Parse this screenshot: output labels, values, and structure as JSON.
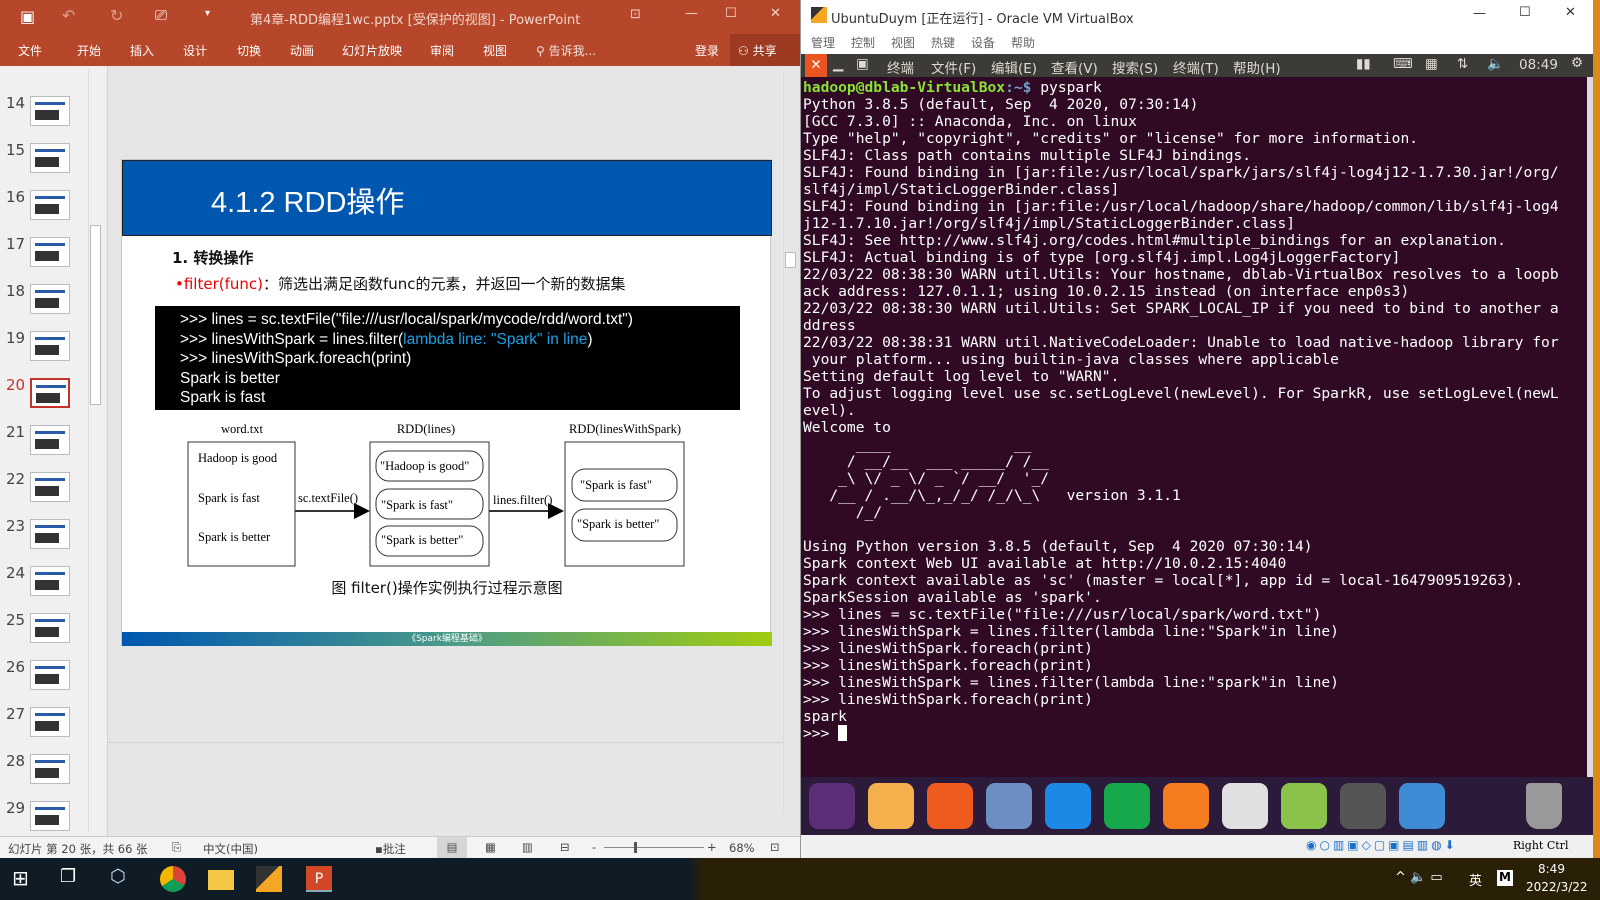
{
  "ppt": {
    "title": "第4章-RDD编程1wc.pptx [受保护的视图] - PowerPoint",
    "tabs": [
      "文件",
      "开始",
      "插入",
      "设计",
      "切换",
      "动画",
      "幻灯片放映",
      "审阅",
      "视图"
    ],
    "tell_me": "告诉我...",
    "login": "登录",
    "share": "共享",
    "thumbnails": [
      "14",
      "15",
      "16",
      "17",
      "18",
      "19",
      "20",
      "21",
      "22",
      "23",
      "24",
      "25",
      "26",
      "27",
      "28",
      "29"
    ],
    "selected_slide": "20",
    "status": {
      "slide_info": "幻灯片 第 20 张，共 66 张",
      "language": "中文(中国)",
      "comments": "批注",
      "zoom": "68%"
    }
  },
  "slide": {
    "title": "4.1.2 RDD操作",
    "heading": "1. 转换操作",
    "bullet_red": "•filter(func)",
    "bullet_rest": "：筛选出满足函数func的元素，并返回一个新的数据集",
    "code": [
      {
        "text": ">>>  lines = sc.textFile(\"file:///usr/local/spark/mycode/rdd/word.txt\")"
      },
      {
        "text": ">>>  linesWithSpark = lines.filter(",
        "hl": "lambda line: \"Spark\" in line",
        "tail": ")"
      },
      {
        "text": ">>> linesWithSpark.foreach(print)"
      },
      {
        "text": "Spark is better"
      },
      {
        "text": "Spark is fast"
      }
    ],
    "diagram": {
      "box1_label": "word.txt",
      "box1_items": [
        "Hadoop is good",
        "Spark is fast",
        "Spark is better"
      ],
      "arrow1": "sc.textFile()",
      "box2_label": "RDD(lines)",
      "box2_items": [
        "\"Hadoop is good\"",
        "\"Spark is fast\"",
        "\"Spark is better\""
      ],
      "arrow2": "lines.filter()",
      "box3_label": "RDD(linesWithSpark)",
      "box3_items": [
        "\"Spark is fast\"",
        "\"Spark is better\""
      ]
    },
    "caption": "图 filter()操作实例执行过程示意图",
    "footer": "《Spark编程基础》"
  },
  "vbox": {
    "title": "UbuntuDuym [正在运行] - Oracle VM VirtualBox",
    "menu": [
      "管理",
      "控制",
      "视图",
      "热键",
      "设备",
      "帮助"
    ],
    "ubuntu_bar": {
      "app": "终端",
      "menus": [
        "文件(F)",
        "编辑(E)",
        "查看(V)",
        "搜索(S)",
        "终端(T)",
        "帮助(H)"
      ],
      "clock": "08:49"
    },
    "prompt_user": "hadoop@dblab-VirtualBox",
    "prompt_path": ":~$ ",
    "prompt_cmd": "pyspark",
    "terminal_lines": [
      "Python 3.8.5 (default, Sep  4 2020, 07:30:14)",
      "[GCC 7.3.0] :: Anaconda, Inc. on linux",
      "Type \"help\", \"copyright\", \"credits\" or \"license\" for more information.",
      "SLF4J: Class path contains multiple SLF4J bindings.",
      "SLF4J: Found binding in [jar:file:/usr/local/spark/jars/slf4j-log4j12-1.7.30.jar!/org/",
      "slf4j/impl/StaticLoggerBinder.class]",
      "SLF4J: Found binding in [jar:file:/usr/local/hadoop/share/hadoop/common/lib/slf4j-log4",
      "j12-1.7.10.jar!/org/slf4j/impl/StaticLoggerBinder.class]",
      "SLF4J: See http://www.slf4j.org/codes.html#multiple_bindings for an explanation.",
      "SLF4J: Actual binding is of type [org.slf4j.impl.Log4jLoggerFactory]",
      "22/03/22 08:38:30 WARN util.Utils: Your hostname, dblab-VirtualBox resolves to a loopb",
      "ack address: 127.0.1.1; using 10.0.2.15 instead (on interface enp0s3)",
      "22/03/22 08:38:30 WARN util.Utils: Set SPARK_LOCAL_IP if you need to bind to another a",
      "ddress",
      "22/03/22 08:38:31 WARN util.NativeCodeLoader: Unable to load native-hadoop library for",
      " your platform... using builtin-java classes where applicable",
      "Setting default log level to \"WARN\".",
      "To adjust logging level use sc.setLogLevel(newLevel). For SparkR, use setLogLevel(newL",
      "evel).",
      "Welcome to",
      "      ____              __",
      "     / __/__  ___ _____/ /__",
      "    _\\ \\/ _ \\/ _ `/ __/  '_/",
      "   /__ / .__/\\_,_/_/ /_/\\_\\   version 3.1.1",
      "      /_/",
      "",
      "Using Python version 3.8.5 (default, Sep  4 2020 07:30:14)",
      "Spark context Web UI available at http://10.0.2.15:4040",
      "Spark context available as 'sc' (master = local[*], app id = local-1647909519263).",
      "SparkSession available as 'spark'.",
      ">>> lines = sc.textFile(\"file:///usr/local/spark/word.txt\")",
      ">>> linesWithSpark = lines.filter(lambda line:\"Spark\"in line)",
      ">>> linesWithSpark.foreach(print)",
      ">>> linesWithSpark.foreach(print)",
      ">>> linesWithSpark = lines.filter(lambda line:\"spark\"in line)",
      ">>> linesWithSpark.foreach(print)",
      "spark"
    ],
    "final_prompt": ">>> ",
    "dock": [
      {
        "name": "ubuntu-icon",
        "color": "#5e2d79"
      },
      {
        "name": "files-icon",
        "color": "#f5b04e"
      },
      {
        "name": "firefox-icon",
        "color": "#ef5a1e"
      },
      {
        "name": "chromium-icon",
        "color": "#6b8fc2"
      },
      {
        "name": "word-icon",
        "color": "#1e88e5"
      },
      {
        "name": "excel-icon",
        "color": "#16a84a"
      },
      {
        "name": "powerpoint-icon",
        "color": "#f57c1f"
      },
      {
        "name": "ubuntu-software-icon",
        "color": "#e0e0e0"
      },
      {
        "name": "store-icon",
        "color": "#8bc34a"
      },
      {
        "name": "terminal-icon",
        "color": "#555555"
      },
      {
        "name": "workspace-icon",
        "color": "#3f8bd6"
      }
    ],
    "host_key": "Right Ctrl"
  },
  "taskbar": {
    "time": "8:49",
    "date": "2022/3/22",
    "ime": "英",
    "ime2": "M"
  },
  "colors": {
    "ppt_accent": "#b7472a",
    "slide_blue": "#0057b0",
    "terminal_bg": "#300a24",
    "prompt_green": "#8ae234"
  }
}
